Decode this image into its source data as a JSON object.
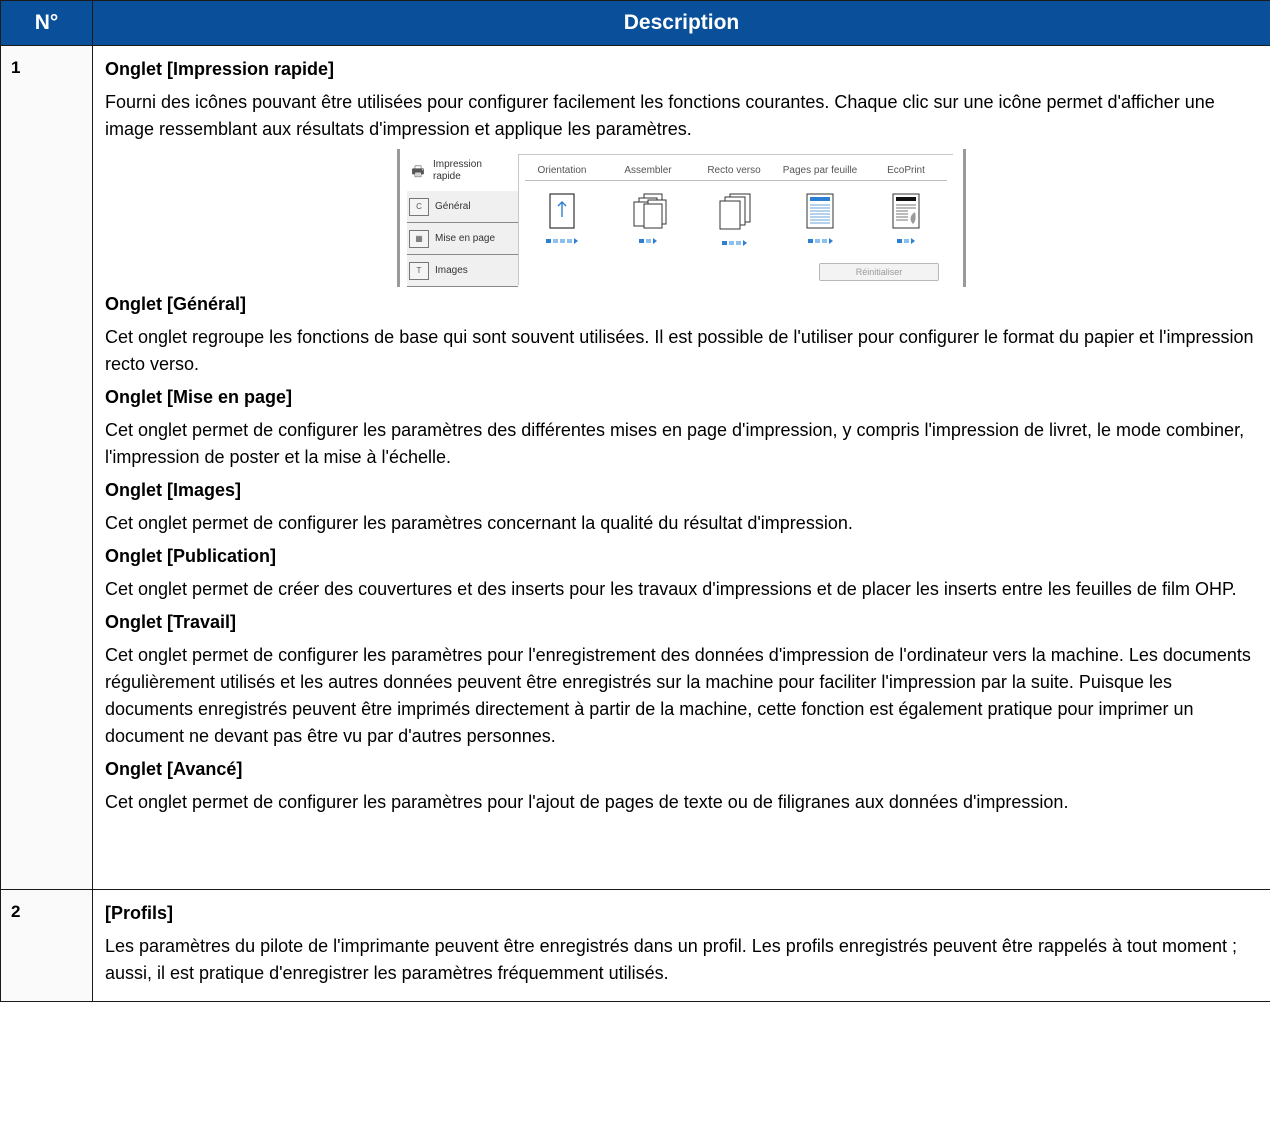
{
  "header": {
    "num_label": "N°",
    "desc_label": "Description"
  },
  "row1": {
    "num": "1",
    "sections": [
      {
        "title": "Onglet [Impression rapide]",
        "text": "Fourni des icônes pouvant être utilisées pour configurer facilement les fonctions courantes. Chaque clic sur une icône permet d'afficher une image ressemblant aux résultats d'impression et applique les paramètres."
      },
      {
        "title": "Onglet [Général]",
        "text": "Cet onglet regroupe les fonctions de base qui sont souvent utilisées. Il est possible de l'utiliser pour configurer le format du papier et l'impression recto verso."
      },
      {
        "title": "Onglet [Mise en page]",
        "text": "Cet onglet permet de configurer les paramètres des différentes mises en page d'impression, y compris l'impression de livret, le mode combiner, l'impression de poster et la mise à l'échelle."
      },
      {
        "title": "Onglet [Images]",
        "text": "Cet onglet permet de configurer les paramètres concernant la qualité du résultat d'impression."
      },
      {
        "title": "Onglet [Publication]",
        "text": "Cet onglet permet de créer des couvertures et des inserts pour les travaux d'impressions et de placer les inserts entre les feuilles de film OHP."
      },
      {
        "title": "Onglet [Travail]",
        "text": "Cet onglet permet de configurer les paramètres pour l'enregistrement des données d'impression de l'ordinateur vers la machine. Les documents régulièrement utilisés et les autres données peuvent être enregistrés sur la machine pour faciliter l'impression par la suite. Puisque les documents enregistrés peuvent être imprimés directement à partir de la machine, cette fonction est également pratique pour imprimer un document ne devant pas être vu par d'autres personnes."
      },
      {
        "title": "Onglet [Avancé]",
        "text": "Cet onglet permet de configurer les paramètres pour l'ajout de pages de texte ou de filigranes aux données d'impression."
      }
    ],
    "screenshot": {
      "tabs": [
        "Impression rapide",
        "Général",
        "Mise en page",
        "Images"
      ],
      "columns": [
        "Orientation",
        "Assembler",
        "Recto verso",
        "Pages par feuille",
        "EcoPrint"
      ],
      "reset_label": "Réinitialiser"
    }
  },
  "row2": {
    "num": "2",
    "title": "[Profils]",
    "text": "Les paramètres du pilote de l'imprimante peuvent être enregistrés dans un profil. Les profils enregistrés peuvent être rappelés à tout moment ; aussi, il est pratique d'enregistrer les paramètres fréquemment utilisés."
  }
}
